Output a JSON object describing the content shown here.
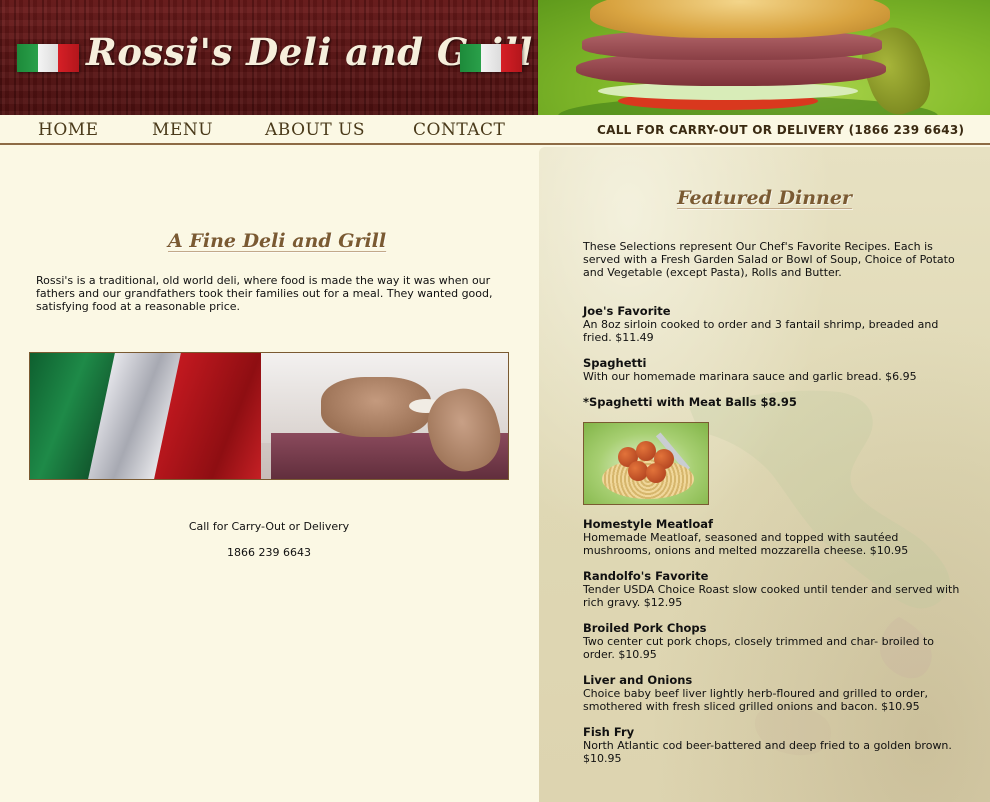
{
  "header": {
    "site_title": "Rossi's Deli and Grill"
  },
  "nav": {
    "items": [
      {
        "label": "HOME"
      },
      {
        "label": "MENU"
      },
      {
        "label": "ABOUT US"
      },
      {
        "label": "CONTACT"
      }
    ],
    "phone_banner": "CALL FOR CARRY-OUT OR DELIVERY (1866 239 6643)"
  },
  "intro": {
    "heading": "A Fine Deli and Grill",
    "text": "Rossi's is a traditional, old world deli, where food is made the way it was when our fathers and our grandfathers took their families out for a meal. They wanted good, satisfying food at a reasonable price.",
    "call_label": "Call for Carry-Out or Delivery",
    "call_number": "1866 239 6643"
  },
  "featured": {
    "heading": "Featured Dinner",
    "intro": "These Selections represent Our Chef's Favorite Recipes. Each is served with a Fresh Garden Salad or Bowl of Soup, Choice of Potato and Vegetable (except Pasta), Rolls and Butter.",
    "dishes": [
      {
        "name": "Joe's Favorite",
        "description": "An 8oz sirloin cooked to order and 3 fantail shrimp, breaded and fried. $11.49"
      },
      {
        "name": "Spaghetti",
        "description": "With our homemade marinara sauce and garlic bread. $6.95"
      },
      {
        "name": "*Spaghetti with Meat Balls $8.95",
        "description": ""
      },
      {
        "name": "Homestyle Meatloaf",
        "description": "Homemade Meatloaf, seasoned and topped with sautéed mushrooms, onions and melted mozzarella cheese. $10.95"
      },
      {
        "name": "Randolfo's Favorite",
        "description": "Tender USDA Choice Roast slow cooked until tender and served with rich gravy. $12.95"
      },
      {
        "name": "Broiled Pork Chops",
        "description": "Two center cut pork chops, closely trimmed and char- broiled to order. $10.95"
      },
      {
        "name": "Liver and Onions",
        "description": "Choice baby beef liver lightly herb-floured and grilled to order, smothered with fresh sliced grilled onions and bacon. $10.95"
      },
      {
        "name": "Fish Fry",
        "description": "North Atlantic cod beer-battered and deep fried to a golden brown. $10.95"
      }
    ]
  },
  "colors": {
    "header_wood": "#5a1414",
    "page_background": "#fbf8e4",
    "nav_text": "#4a3a1a",
    "heading_brown": "#7a5a32",
    "menu_parchment": "#dfd8b4"
  },
  "icons": [
    "italian-flag-icon"
  ]
}
